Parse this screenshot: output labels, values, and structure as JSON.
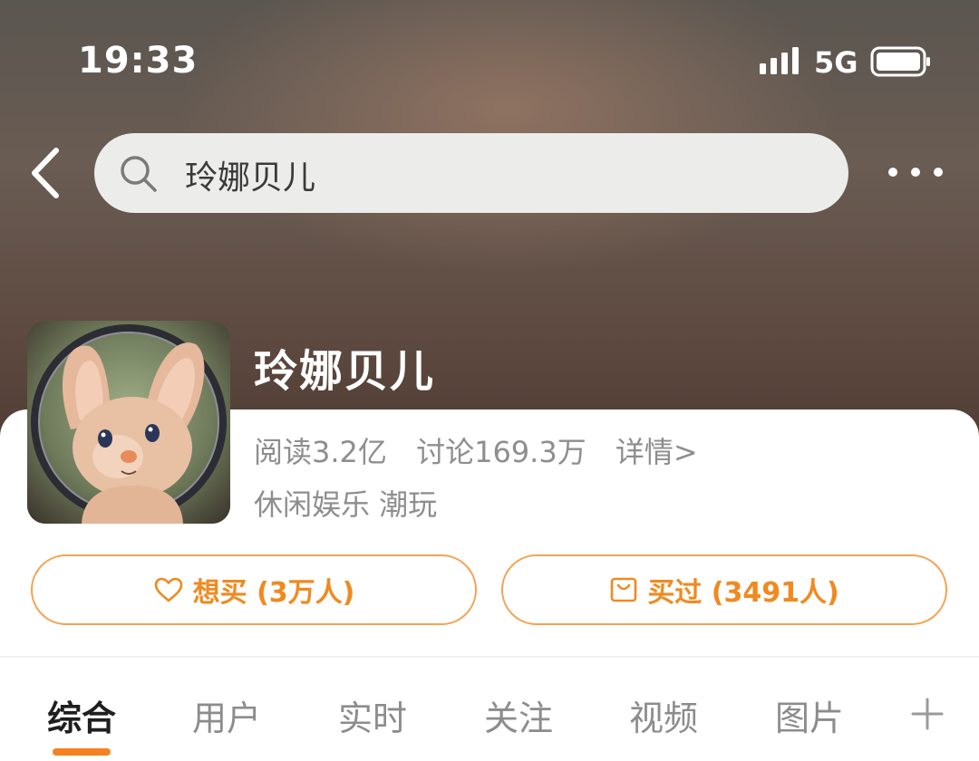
{
  "status_bar": {
    "time": "19:33",
    "network": "5G",
    "icons": [
      "signal-icon",
      "battery-icon"
    ]
  },
  "header": {
    "back_icon": "chevron-left-icon",
    "search_icon": "search-icon",
    "search_value": "玲娜贝儿",
    "more_icon": "more-dots-icon"
  },
  "topic": {
    "title": "玲娜贝儿",
    "avatar_icon": "avatar-plush-fox",
    "reads": "阅读3.2亿",
    "discussions": "讨论169.3万",
    "detail_link": "详情>",
    "categories": "休闲娱乐 潮玩"
  },
  "actions": {
    "want_label": "想买 (3万人)",
    "want_icon": "heart-icon",
    "bought_label": "买过 (3491人)",
    "bought_icon": "shopping-bag-icon",
    "accent_color": "#f08a20"
  },
  "tabs": {
    "items": [
      "综合",
      "用户",
      "实时",
      "关注",
      "视频",
      "图片"
    ],
    "active_index": 0,
    "add_icon": "plus-icon",
    "indicator_color": "#f5821f"
  }
}
